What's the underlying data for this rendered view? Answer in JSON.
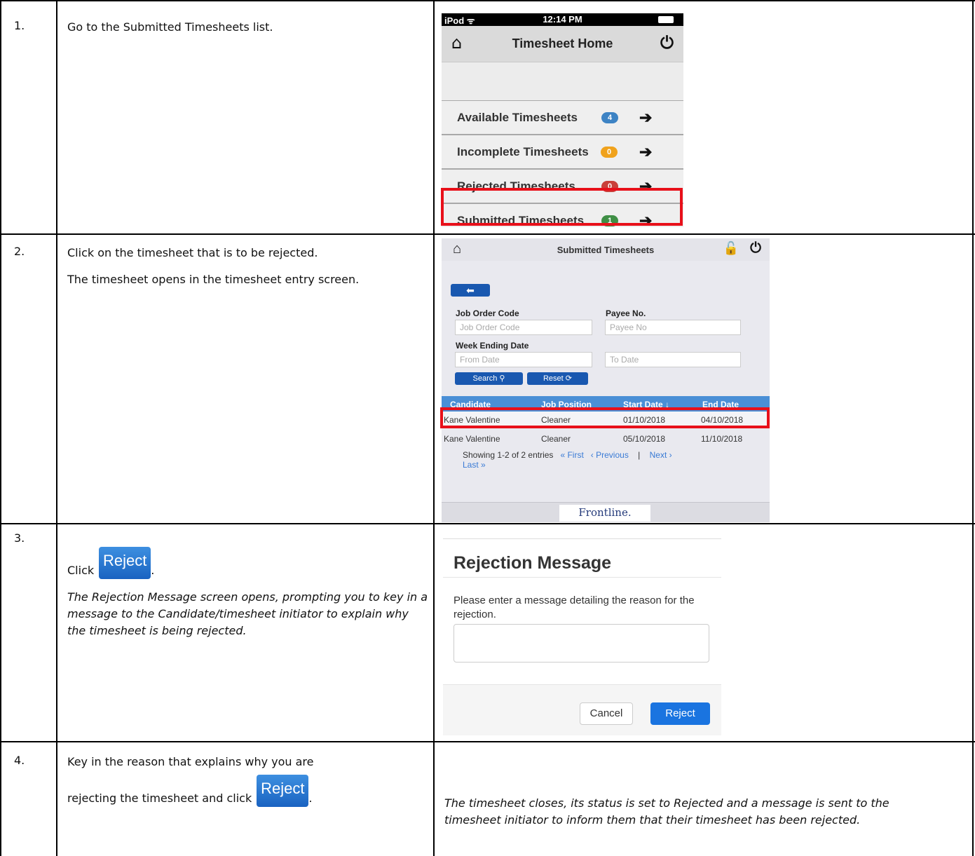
{
  "steps": [
    {
      "number": "1.",
      "description": "Go to the Submitted Timesheets list."
    },
    {
      "number": "2.",
      "description_line1": "Click on the timesheet that is to be rejected.",
      "description_line2": "The timesheet opens in the timesheet entry screen."
    },
    {
      "number": "3.",
      "click_prefix": "Click",
      "click_button": "Reject",
      "click_suffix": ".",
      "note": "The Rejection Message screen opens, prompting you to key in a message to the Candidate/timesheet initiator to explain why the timesheet is being rejected."
    },
    {
      "number": "4.",
      "instruction_line1": "Key in the reason that explains why you are",
      "instruction_line2_prefix": "rejecting the timesheet and click",
      "instruction_button": "Reject",
      "instruction_suffix": ".",
      "result": "The timesheet closes, its status is set to Rejected and a message is sent to the timesheet initiator to inform them that their timesheet has been rejected."
    }
  ],
  "timesheet_home": {
    "carrier": "iPod ᯤ",
    "time": "12:14 PM",
    "title": "Timesheet Home",
    "home_icon": "⌂",
    "power_icon": "⏻",
    "items": [
      {
        "label": "Available Timesheets",
        "count": "4",
        "color": "#3d83c4"
      },
      {
        "label": "Incomplete Timesheets",
        "count": "0",
        "color": "#f0a21c"
      },
      {
        "label": "Rejected Timesheets",
        "count": "0",
        "color": "#c9403a"
      },
      {
        "label": "Submitted Timesheets",
        "count": "1",
        "color": "#3f8f45"
      }
    ],
    "arrow": "➔"
  },
  "submitted_screen": {
    "title": "Submitted Timesheets",
    "back": "⬅",
    "job_order_label": "Job Order Code",
    "job_order_placeholder": "Job Order Code",
    "payee_label": "Payee No.",
    "payee_placeholder": "Payee No",
    "week_label": "Week Ending Date",
    "from_placeholder": "From Date",
    "to_placeholder": "To Date",
    "search_button": "Search ⚲",
    "reset_button": "Reset ⟳",
    "columns": [
      "Candidate",
      "Job Position",
      "Start Date ↓",
      "End Date"
    ],
    "rows": [
      [
        "Kane Valentine",
        "Cleaner",
        "01/10/2018",
        "04/10/2018"
      ],
      [
        "Kane Valentine",
        "Cleaner",
        "05/10/2018",
        "11/10/2018"
      ]
    ],
    "pager_text": "Showing 1-2 of 2 entries",
    "pager_first": "« First",
    "pager_previous": "‹ Previous",
    "pager_sep": "|",
    "pager_next": "Next ›",
    "pager_last": "Last »",
    "logo": "Frontline."
  },
  "rejection_modal": {
    "title": "Rejection Message",
    "prompt": "Please enter a message detailing the reason for the rejection.",
    "cancel": "Cancel",
    "reject": "Reject"
  }
}
